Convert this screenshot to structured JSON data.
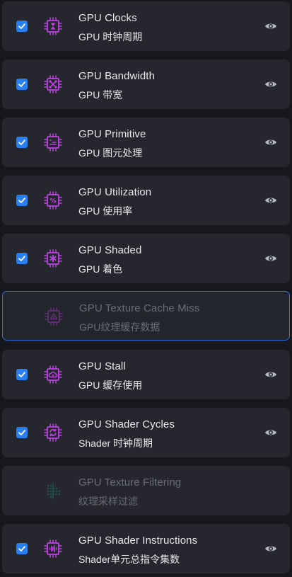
{
  "colors": {
    "accent": "#2a7ff0",
    "icon_purple": "#c043e6",
    "icon_teal": "#1f8f7a",
    "active_border": "#2e6fd8"
  },
  "items": [
    {
      "title": "GPU Clocks",
      "subtitle": "GPU 时钟周期",
      "checked": true,
      "icon": "hourglass-chip-icon",
      "dim": false,
      "active": false,
      "visible_eye": true
    },
    {
      "title": "GPU Bandwidth",
      "subtitle": "GPU 带宽",
      "checked": true,
      "icon": "bandwidth-chip-icon",
      "dim": false,
      "active": false,
      "visible_eye": true
    },
    {
      "title": "GPU Primitive",
      "subtitle": "GPU 图元处理",
      "checked": true,
      "icon": "primitive-chip-icon",
      "dim": false,
      "active": false,
      "visible_eye": true
    },
    {
      "title": "GPU Utilization",
      "subtitle": "GPU 使用率",
      "checked": true,
      "icon": "percent-chip-icon",
      "dim": false,
      "active": false,
      "visible_eye": true
    },
    {
      "title": "GPU Shaded",
      "subtitle": "GPU 着色",
      "checked": true,
      "icon": "asterisk-chip-icon",
      "dim": false,
      "active": false,
      "visible_eye": true
    },
    {
      "title": "GPU Texture Cache Miss",
      "subtitle": "GPU纹理缓存数据",
      "checked": false,
      "icon": "cache-chip-icon",
      "dim": true,
      "active": true,
      "visible_eye": false
    },
    {
      "title": "GPU Stall",
      "subtitle": "GPU 缓存使用",
      "checked": true,
      "icon": "cloud-chip-icon",
      "dim": false,
      "active": false,
      "visible_eye": true
    },
    {
      "title": "GPU Shader Cycles",
      "subtitle": "Shader 时钟周期",
      "checked": true,
      "icon": "cycle-chip-icon",
      "dim": false,
      "active": false,
      "visible_eye": true
    },
    {
      "title": "GPU Texture Filtering",
      "subtitle": "纹理采样过滤",
      "checked": false,
      "icon": "filter-dots-icon",
      "dim": true,
      "active": false,
      "visible_eye": false
    },
    {
      "title": "GPU Shader Instructions",
      "subtitle": "Shader单元总指令集数",
      "checked": true,
      "icon": "waveform-chip-icon",
      "dim": false,
      "active": false,
      "visible_eye": true
    }
  ]
}
